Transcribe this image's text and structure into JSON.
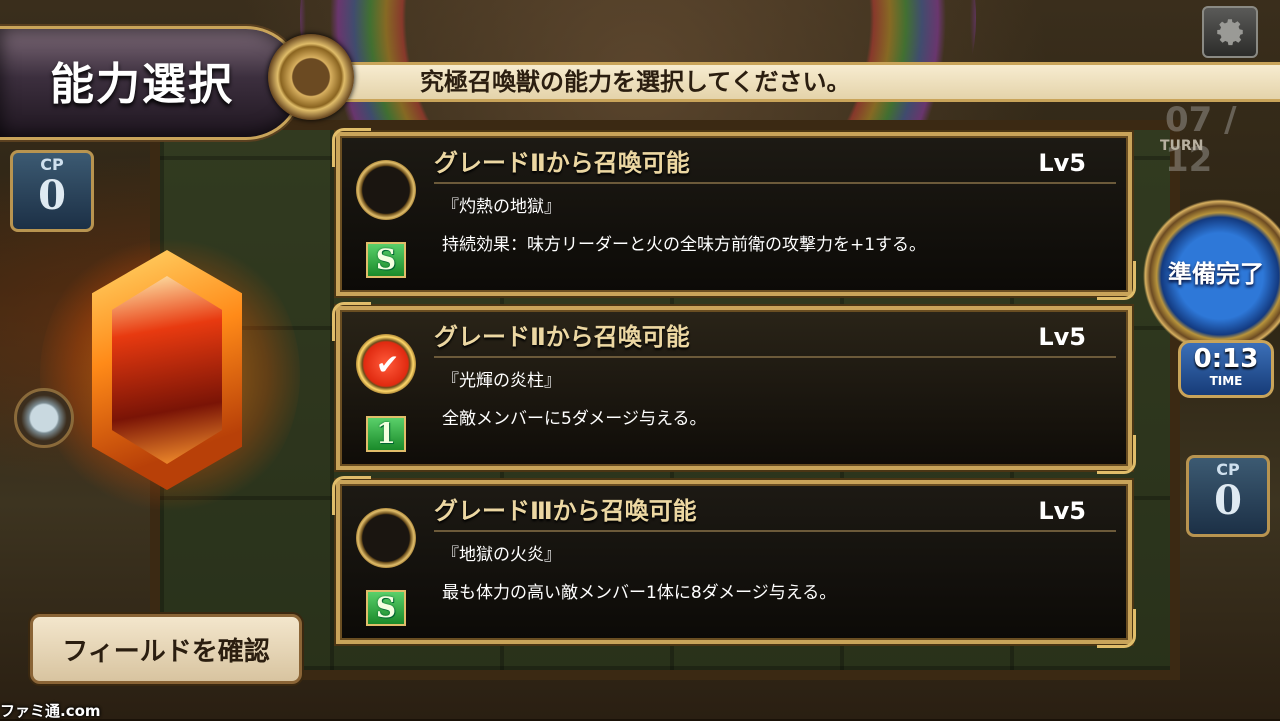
{
  "header": {
    "title": "能力選択",
    "instruction": "究極召喚獣の能力を選択してください。"
  },
  "left_panel": {
    "cp_label": "CP",
    "cp_value": "0",
    "field_button_label": "フィールドを確認"
  },
  "right_panel": {
    "turn_count": "07 / 12",
    "turn_label": "TURN",
    "ready_label": "準備完了",
    "timer_value": "0:13",
    "timer_label": "TIME",
    "cp_label": "CP",
    "cp_value": "0"
  },
  "options": [
    {
      "title": "グレードⅡから召喚可能",
      "level": "Lv5",
      "name": "『灼熱の地獄』",
      "description": "持続効果：味方リーダーと火の全味方前衛の攻撃力を+1する。",
      "badge": "S",
      "selected": false
    },
    {
      "title": "グレードⅡから召喚可能",
      "level": "Lv5",
      "name": "『光輝の炎柱』",
      "description": "全敵メンバーに5ダメージ与える。",
      "badge": "1",
      "selected": true
    },
    {
      "title": "グレードⅢから召喚可能",
      "level": "Lv5",
      "name": "『地獄の火炎』",
      "description": "最も体力の高い敵メンバー1体に8ダメージ与える。",
      "badge": "S",
      "selected": false
    }
  ],
  "check_glyph": "✔",
  "watermark": "ファミ通.com",
  "colors": {
    "gold_frame": "#c9a45a",
    "selected_check": "#e02a10",
    "ready_button": "#2e78d8"
  }
}
